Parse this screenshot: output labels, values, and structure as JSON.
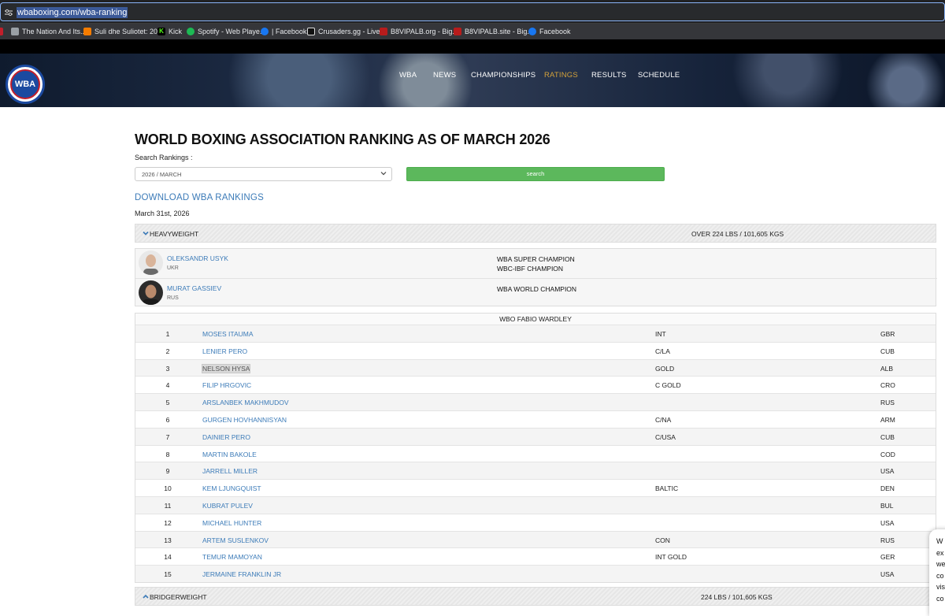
{
  "browser": {
    "url": "wbaboxing.com/wba-ranking",
    "bookmarks": [
      {
        "label": "The Nation And Its...",
        "color": "#c21f2b"
      },
      {
        "label": "Suli dhe Suliotet: 20...",
        "color": "#f57c00"
      },
      {
        "label": "Kick",
        "color": "#53fc18"
      },
      {
        "label": "Spotify - Web Playe...",
        "color": "#1db954"
      },
      {
        "label": "| Facebook",
        "color": "#1877f2"
      },
      {
        "label": "Crusaders.gg - Live...",
        "color": "#ffffff"
      },
      {
        "label": "B8VIPALB.org - Big...",
        "color": "#b71c1c"
      },
      {
        "label": "B8VIPALB.site - Big...",
        "color": "#b71c1c"
      },
      {
        "label": "Facebook",
        "color": "#1877f2"
      }
    ]
  },
  "site": {
    "logo_text": "WBA",
    "nav": [
      "WBA",
      "NEWS",
      "CHAMPIONSHIPS",
      "RATINGS",
      "RESULTS",
      "SCHEDULE"
    ],
    "active_nav": "RATINGS",
    "accent": "#d3a13a",
    "link_color": "#3c7bb8",
    "button_color": "#5cb85c"
  },
  "page": {
    "title": "WORLD BOXING ASSOCIATION RANKING AS OF MARCH 2026",
    "search_label": "Search Rankings :",
    "select_value": "2026 / MARCH",
    "search_button": "search",
    "download_link": "DOWNLOAD WBA RANKINGS",
    "date": "March 31st, 2026"
  },
  "heavyweight": {
    "name": "HEAVYWEIGHT",
    "weight": "OVER 224 LBS / 101,605 KGS",
    "champions": [
      {
        "name": "OLEKSANDR USYK",
        "country": "UKR",
        "titles": [
          "WBA SUPER CHAMPION",
          "WBC-IBF CHAMPION"
        ]
      },
      {
        "name": "MURAT GASSIEV",
        "country": "RUS",
        "titles": [
          "WBA WORLD CHAMPION"
        ]
      }
    ],
    "wbo_note": "WBO FABIO WARDLEY",
    "rankings": [
      {
        "rank": "1",
        "name": "MOSES ITAUMA",
        "title": "INT",
        "country": "GBR"
      },
      {
        "rank": "2",
        "name": "LENIER PERO",
        "title": "C/LA",
        "country": "CUB"
      },
      {
        "rank": "3",
        "name": "NELSON HYSA",
        "title": "GOLD",
        "country": "ALB"
      },
      {
        "rank": "4",
        "name": "FILIP HRGOVIC",
        "title": "C GOLD",
        "country": "CRO"
      },
      {
        "rank": "5",
        "name": "ARSLANBEK MAKHMUDOV",
        "title": "",
        "country": "RUS"
      },
      {
        "rank": "6",
        "name": "GURGEN HOVHANNISYAN",
        "title": "C/NA",
        "country": "ARM"
      },
      {
        "rank": "7",
        "name": "DAINIER PERO",
        "title": "C/USA",
        "country": "CUB"
      },
      {
        "rank": "8",
        "name": "MARTIN BAKOLE",
        "title": "",
        "country": "COD"
      },
      {
        "rank": "9",
        "name": "JARRELL MILLER",
        "title": "",
        "country": "USA"
      },
      {
        "rank": "10",
        "name": "KEM LJUNGQUIST",
        "title": "BALTIC",
        "country": "DEN"
      },
      {
        "rank": "11",
        "name": "KUBRAT PULEV",
        "title": "",
        "country": "BUL"
      },
      {
        "rank": "12",
        "name": "MICHAEL HUNTER",
        "title": "",
        "country": "USA"
      },
      {
        "rank": "13",
        "name": "ARTEM SUSLENKOV",
        "title": "CON",
        "country": "RUS"
      },
      {
        "rank": "14",
        "name": "TEMUR MAMOYAN",
        "title": "INT GOLD",
        "country": "GER"
      },
      {
        "rank": "15",
        "name": "JERMAINE FRANKLIN JR",
        "title": "",
        "country": "USA"
      }
    ]
  },
  "bridgerweight": {
    "name": "BRIDGERWEIGHT",
    "weight": "224 LBS / 101,605 KGS"
  },
  "cookie_fragment": [
    "W",
    "ex",
    "we",
    "co",
    "vis",
    "co"
  ]
}
